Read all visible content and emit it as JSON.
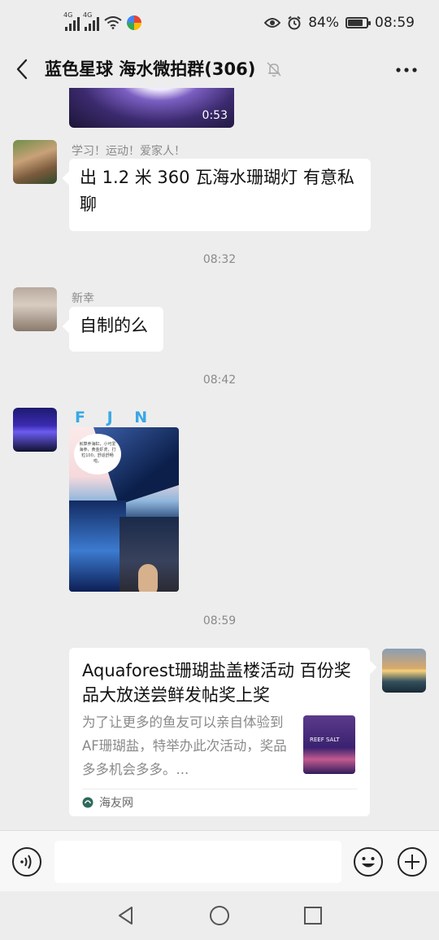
{
  "status_bar": {
    "sim1_label": "4G",
    "sim2_label": "4G",
    "battery_text": "84%",
    "battery_level": 0.84,
    "time": "08:59",
    "icons": [
      "signal-icon",
      "signal-icon",
      "wifi-icon",
      "app-icon",
      "eye-icon",
      "alarm-icon",
      "battery-icon"
    ]
  },
  "header": {
    "title": "蓝色星球 海水微拍群(306)",
    "icons": [
      "back-arrow-icon",
      "mute-bell-icon",
      "more-dots-icon"
    ]
  },
  "messages": {
    "video": {
      "duration": "0:53"
    },
    "msg1": {
      "sender": "学习！运动！爱家人！",
      "text": "出 1.2 米 360 瓦海水珊瑚灯 有意私聊"
    },
    "time1": "08:32",
    "msg2": {
      "sender": "新幸",
      "text": "自制的么"
    },
    "time2": "08:42",
    "msg3": {
      "sender": "F J N",
      "image_caption": "就算养海缸，小可爱海参，黄金虾虎，打粒100，舒适舒畅啦。"
    },
    "time3": "08:59",
    "link_card": {
      "title": "Aquaforest珊瑚盐盖楼活动 百份奖品大放送尝鲜发帖奖上奖",
      "description": "为了让更多的鱼友可以亲自体验到AF珊瑚盐，特举办此次活动，奖品多多机会多多。...",
      "thumb_text": "REEF SALT",
      "source": "海友网"
    }
  },
  "input_bar": {
    "placeholder": "",
    "icons": [
      "voice-icon",
      "emoji-icon",
      "plus-icon"
    ]
  },
  "system_nav": {
    "icons": [
      "nav-back-icon",
      "nav-home-icon",
      "nav-recent-icon"
    ]
  },
  "colors": {
    "background": "#ededed",
    "bubble": "#ffffff",
    "meta_text": "#8a8a8a",
    "fjn_name": "#39a8e6"
  }
}
